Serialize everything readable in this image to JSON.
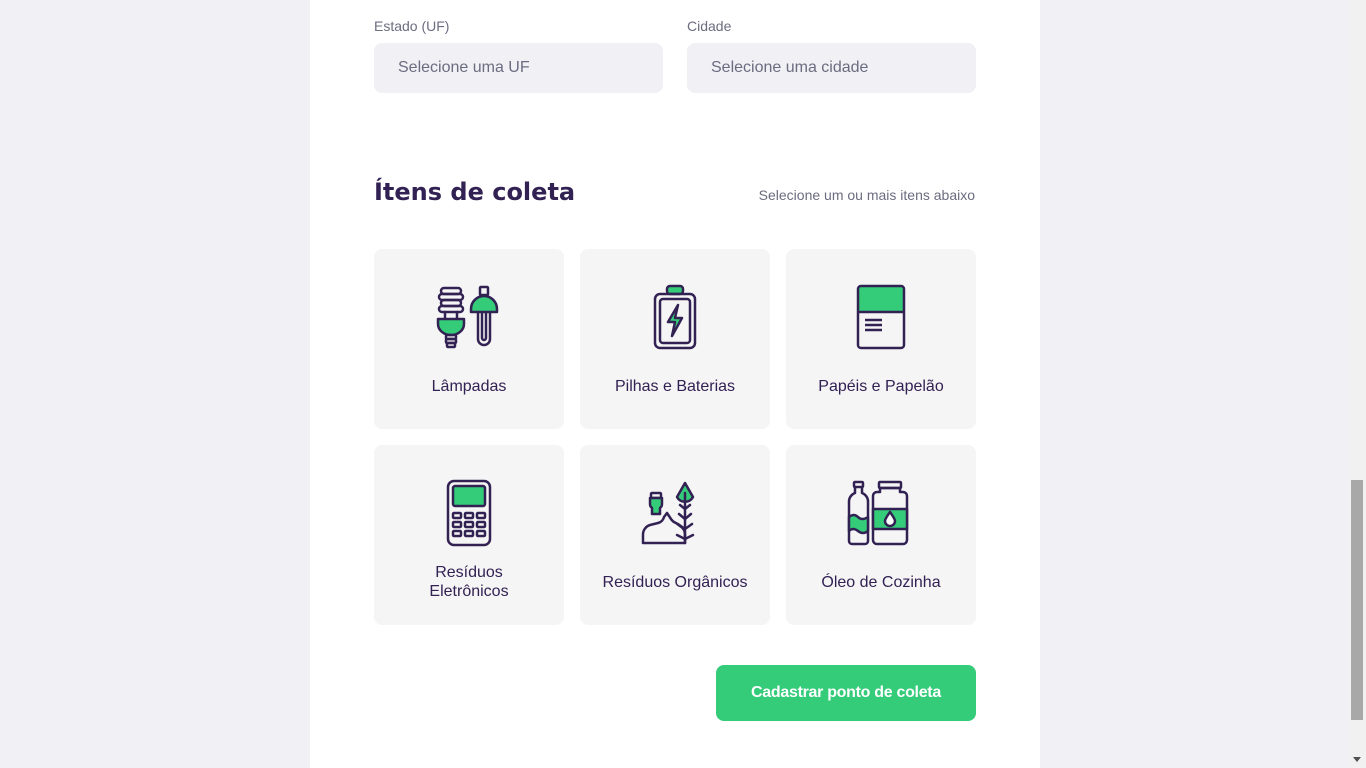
{
  "form": {
    "uf_label": "Estado (UF)",
    "uf_placeholder": "Selecione uma UF",
    "city_label": "Cidade",
    "city_placeholder": "Selecione uma cidade"
  },
  "items_section": {
    "title": "Ítens de coleta",
    "hint": "Selecione um ou mais itens abaixo",
    "items": [
      {
        "label": "Lâmpadas",
        "icon": "lamps-icon"
      },
      {
        "label": "Pilhas e Baterias",
        "icon": "battery-icon"
      },
      {
        "label": "Papéis e Papelão",
        "icon": "paper-icon"
      },
      {
        "label": "Resíduos Eletrônicos",
        "icon": "electronics-icon"
      },
      {
        "label": "Resíduos Orgânicos",
        "icon": "organic-icon"
      },
      {
        "label": "Óleo de Cozinha",
        "icon": "oil-icon"
      }
    ]
  },
  "submit_label": "Cadastrar ponto de coleta",
  "colors": {
    "primary": "#34CB79",
    "title": "#322153",
    "text": "#6C6C80",
    "background": "#F0F0F5"
  }
}
